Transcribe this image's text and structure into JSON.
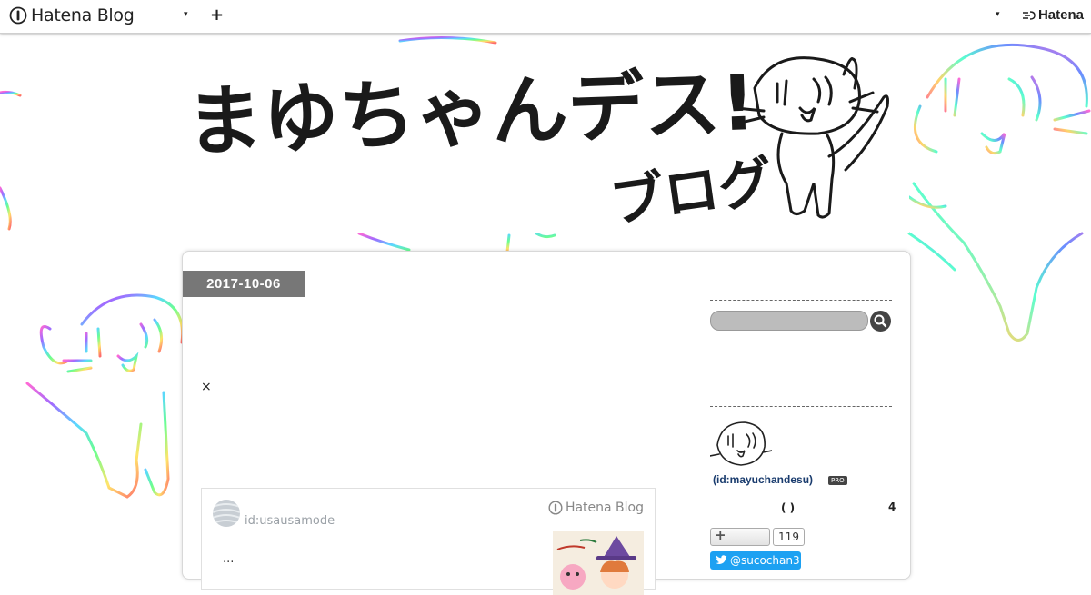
{
  "topbar": {
    "logo_text": "Hatena Blog",
    "plus_label": "+",
    "caret": "▾",
    "right_brand": "Hatena"
  },
  "header": {
    "title_main": "まゆちゃんデス!",
    "title_sub": "ブログ"
  },
  "entry": {
    "date": "2017-10-06",
    "ad_close": "×"
  },
  "embed": {
    "user": "id:usausamode",
    "brand": "Hatena Blog",
    "excerpt": "..."
  },
  "sidebar": {
    "profile_id": "(id:mayuchandesu)",
    "pro_badge": "PRO",
    "paren": "( )",
    "count": "4",
    "readers_plus": "+",
    "readers_count": "119",
    "twitter": "@sucochan3"
  },
  "colors": {
    "badge_bg": "#777777",
    "twitter": "#1da1f2",
    "profile_link": "#1a3c6e"
  },
  "icons": [
    "hatena-blog-logo-icon",
    "caret-down-icon",
    "plus-icon",
    "hatena-logo-icon",
    "search-icon",
    "twitter-bird-icon"
  ]
}
